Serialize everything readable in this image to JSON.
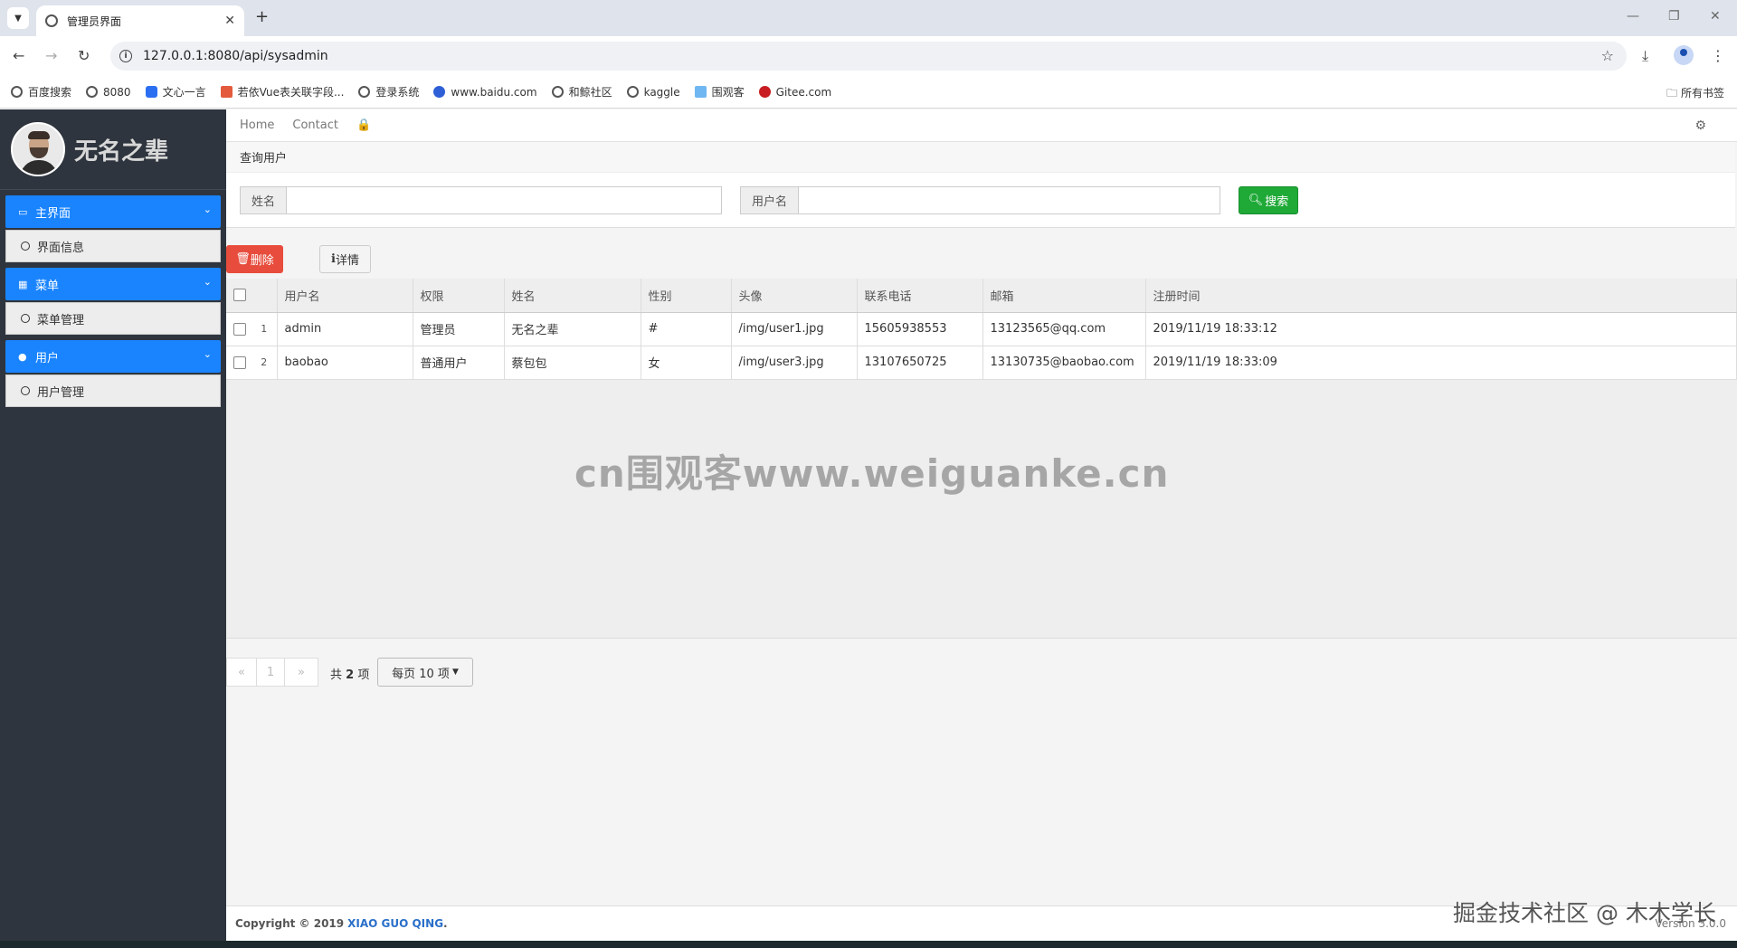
{
  "browser": {
    "tab_title": "管理员界面",
    "url": "127.0.0.1:8080/api/sysadmin",
    "bookmarks": [
      "百度搜索",
      "8080",
      "文心一言",
      "若依Vue表关联字段...",
      "登录系统",
      "www.baidu.com",
      "和鲸社区",
      "kaggle",
      "围观客",
      "Gitee.com"
    ],
    "all_bookmarks": "所有书签"
  },
  "sidebar": {
    "user_name": "无名之辈",
    "menu": [
      {
        "label": "主界面",
        "icon": "monitor-icon",
        "sub": "界面信息"
      },
      {
        "label": "菜单",
        "icon": "grid-icon",
        "sub": "菜单管理"
      },
      {
        "label": "用户",
        "icon": "user-icon",
        "sub": "用户管理"
      }
    ]
  },
  "topnav": {
    "home": "Home",
    "contact": "Contact"
  },
  "search": {
    "title": "查询用户",
    "name_label": "姓名",
    "username_label": "用户名",
    "button": "搜索"
  },
  "actions": {
    "delete": "删除",
    "detail": "详情"
  },
  "table": {
    "headers": [
      "用户名",
      "权限",
      "姓名",
      "性别",
      "头像",
      "联系电话",
      "邮箱",
      "注册时间"
    ],
    "rows": [
      {
        "num": "1",
        "username": "admin",
        "role": "管理员",
        "name": "无名之辈",
        "gender": "#",
        "avatar": "/img/user1.jpg",
        "phone": "15605938553",
        "email": "13123565@qq.com",
        "registered": "2019/11/19 18:33:12"
      },
      {
        "num": "2",
        "username": "baobao",
        "role": "普通用户",
        "name": "蔡包包",
        "gender": "女",
        "avatar": "/img/user3.jpg",
        "phone": "13107650725",
        "email": "13130735@baobao.com",
        "registered": "2019/11/19 18:33:09"
      }
    ]
  },
  "watermark": "cn围观客www.weiguanke.cn",
  "pager": {
    "prev": "«",
    "page": "1",
    "next": "»",
    "total_prefix": "共",
    "total_count": "2",
    "total_suffix": "项",
    "page_size": "每页 10 项"
  },
  "footer": {
    "copyright": "Copyright © 2019",
    "author": "XIAO GUO QING",
    "period": ".",
    "version": "Version 3.0.0",
    "overlay": "掘金技术社区 @ 木木学长"
  }
}
